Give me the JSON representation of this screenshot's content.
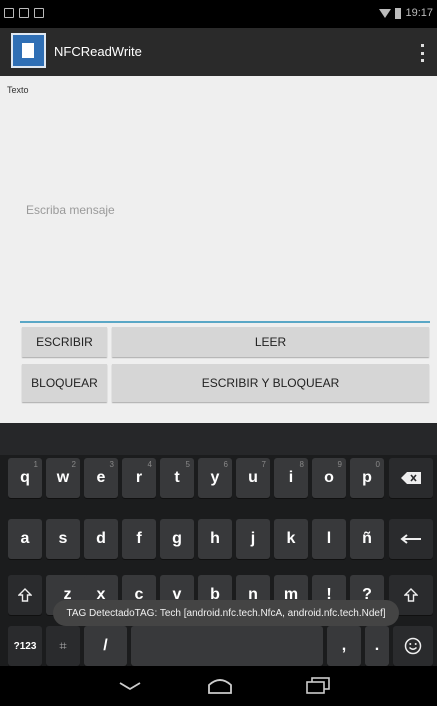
{
  "status_bar": {
    "time": "19:17"
  },
  "action_bar": {
    "title": "NFCReadWrite"
  },
  "content": {
    "field_label": "Texto",
    "message_placeholder": "Escriba mensaje",
    "buttons": {
      "write": "ESCRIBIR",
      "read": "LEER",
      "lock": "BLOQUEAR",
      "write_and_lock": "ESCRIBIR Y BLOQUEAR"
    }
  },
  "keyboard": {
    "row1": [
      {
        "label": "q",
        "hint": "1"
      },
      {
        "label": "w",
        "hint": "2"
      },
      {
        "label": "e",
        "hint": "3"
      },
      {
        "label": "r",
        "hint": "4"
      },
      {
        "label": "t",
        "hint": "5"
      },
      {
        "label": "y",
        "hint": "6"
      },
      {
        "label": "u",
        "hint": "7"
      },
      {
        "label": "i",
        "hint": "8"
      },
      {
        "label": "o",
        "hint": "9"
      },
      {
        "label": "p",
        "hint": "0"
      }
    ],
    "row2": [
      "a",
      "s",
      "d",
      "f",
      "g",
      "h",
      "j",
      "k",
      "l",
      "ñ"
    ],
    "row3": [
      "z",
      "x",
      "c",
      "v",
      "b",
      "n",
      "m",
      "!",
      "?"
    ],
    "row4": {
      "symbols": "?123",
      "emoji_switch": "⌗",
      "slash": "/",
      "comma": ",",
      "period": "."
    }
  },
  "toast": {
    "text": "TAG DetectadoTAG: Tech [android.nfc.tech.NfcA, android.nfc.tech.Ndef]"
  }
}
